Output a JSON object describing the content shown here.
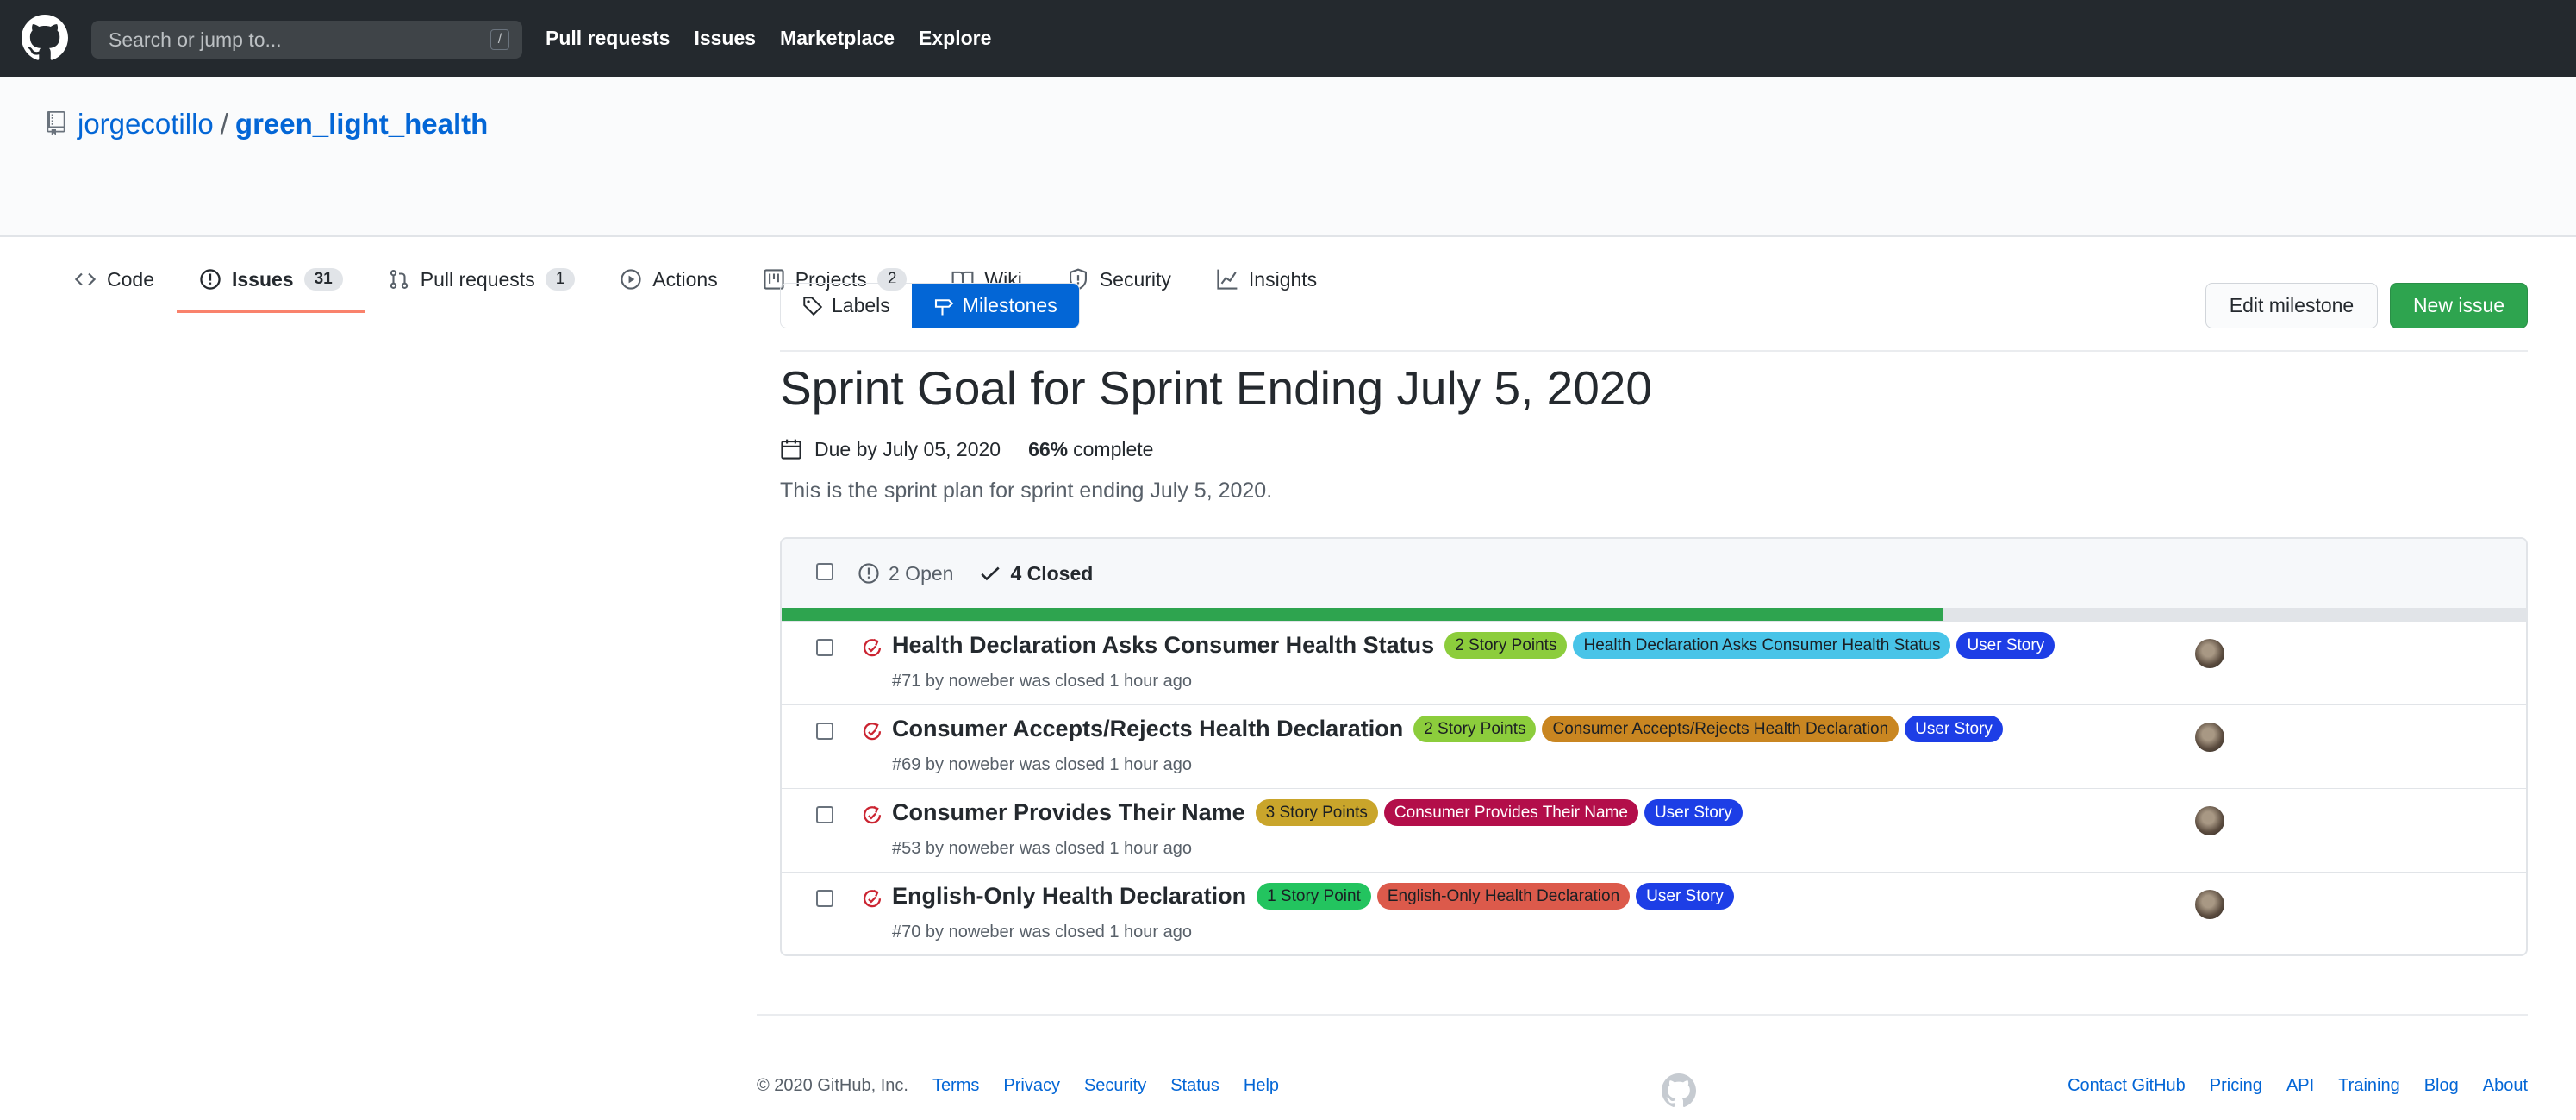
{
  "header": {
    "search_placeholder": "Search or jump to...",
    "search_key": "/",
    "nav": [
      "Pull requests",
      "Issues",
      "Marketplace",
      "Explore"
    ]
  },
  "repo": {
    "owner": "jorgecotillo",
    "separator": "/",
    "name": "green_light_health"
  },
  "repo_tabs": [
    {
      "label": "Code",
      "icon": "code-icon",
      "count": null
    },
    {
      "label": "Issues",
      "icon": "issue-opened-icon",
      "count": "31",
      "active": true
    },
    {
      "label": "Pull requests",
      "icon": "git-pull-request-icon",
      "count": "1"
    },
    {
      "label": "Actions",
      "icon": "play-icon",
      "count": null
    },
    {
      "label": "Projects",
      "icon": "project-icon",
      "count": "2"
    },
    {
      "label": "Wiki",
      "icon": "book-icon",
      "count": null
    },
    {
      "label": "Security",
      "icon": "shield-icon",
      "count": null
    },
    {
      "label": "Insights",
      "icon": "graph-icon",
      "count": null
    }
  ],
  "toolbar": {
    "labels": "Labels",
    "milestones": "Milestones",
    "edit_milestone": "Edit milestone",
    "new_issue": "New issue"
  },
  "milestone": {
    "title": "Sprint Goal for Sprint Ending July 5, 2020",
    "due": "Due by July 05, 2020",
    "percent": "66%",
    "complete_text": "complete",
    "progress": 0.666,
    "description": "This is the sprint plan for sprint ending July 5, 2020."
  },
  "states": {
    "open": "2 Open",
    "closed": "4 Closed"
  },
  "issues": [
    {
      "title": "Health Declaration Asks Consumer Health Status",
      "meta": "#71 by noweber was closed 1 hour ago",
      "labels": [
        {
          "text": "2 Story Points",
          "bg": "#8ccd3c",
          "fg": "#1b1f23"
        },
        {
          "text": "Health Declaration Asks Consumer Health Status",
          "bg": "#48c4e8",
          "fg": "#1b1f23"
        },
        {
          "text": "User Story",
          "bg": "#1d3ee6",
          "fg": "#ffffff"
        }
      ]
    },
    {
      "title": "Consumer Accepts/Rejects Health Declaration",
      "meta": "#69 by noweber was closed 1 hour ago",
      "labels": [
        {
          "text": "2 Story Points",
          "bg": "#8ccd3c",
          "fg": "#1b1f23"
        },
        {
          "text": "Consumer Accepts/Rejects Health Declaration",
          "bg": "#c98621",
          "fg": "#1b1f23"
        },
        {
          "text": "User Story",
          "bg": "#1d3ee6",
          "fg": "#ffffff"
        }
      ]
    },
    {
      "title": "Consumer Provides Their Name",
      "meta": "#53 by noweber was closed 1 hour ago",
      "labels": [
        {
          "text": "3 Story Points",
          "bg": "#c9a52b",
          "fg": "#1b1f23"
        },
        {
          "text": "Consumer Provides Their Name",
          "bg": "#b30e4a",
          "fg": "#ffffff"
        },
        {
          "text": "User Story",
          "bg": "#1d3ee6",
          "fg": "#ffffff"
        }
      ]
    },
    {
      "title": "English-Only Health Declaration",
      "meta": "#70 by noweber was closed 1 hour ago",
      "labels": [
        {
          "text": "1 Story Point",
          "bg": "#23c45f",
          "fg": "#1b1f23"
        },
        {
          "text": "English-Only Health Declaration",
          "bg": "#dc5a4b",
          "fg": "#1b1f23"
        },
        {
          "text": "User Story",
          "bg": "#1d3ee6",
          "fg": "#ffffff"
        }
      ]
    }
  ],
  "footer": {
    "copyright": "© 2020 GitHub, Inc.",
    "left_links": [
      "Terms",
      "Privacy",
      "Security",
      "Status",
      "Help"
    ],
    "right_links": [
      "Contact GitHub",
      "Pricing",
      "API",
      "Training",
      "Blog",
      "About"
    ]
  },
  "colors": {
    "accent": "#0366d6",
    "header_bg": "#24292e",
    "progress": "#2ea44f",
    "new_issue": "#2ea44f",
    "closed_issue_icon": "#cb2431"
  }
}
